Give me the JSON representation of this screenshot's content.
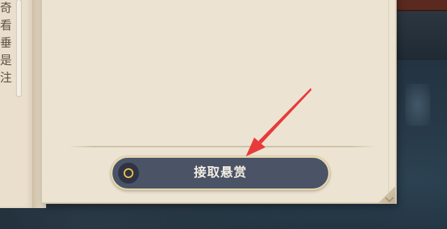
{
  "left_page": {
    "text_fragments": [
      "奇",
      "看",
      "垂",
      "是",
      "注"
    ]
  },
  "action": {
    "accept_label": "接取悬赏",
    "icon": "circle-indicator-icon"
  },
  "overlay": {
    "arrow_icon": "red-pointer-arrow-icon",
    "arrow_color": "#e83a3a"
  },
  "colors": {
    "button_bg": "#4b5366",
    "button_border": "#e8d9b2",
    "page_bg": "#ece3d2",
    "icon_ring": "#f0c24a"
  }
}
